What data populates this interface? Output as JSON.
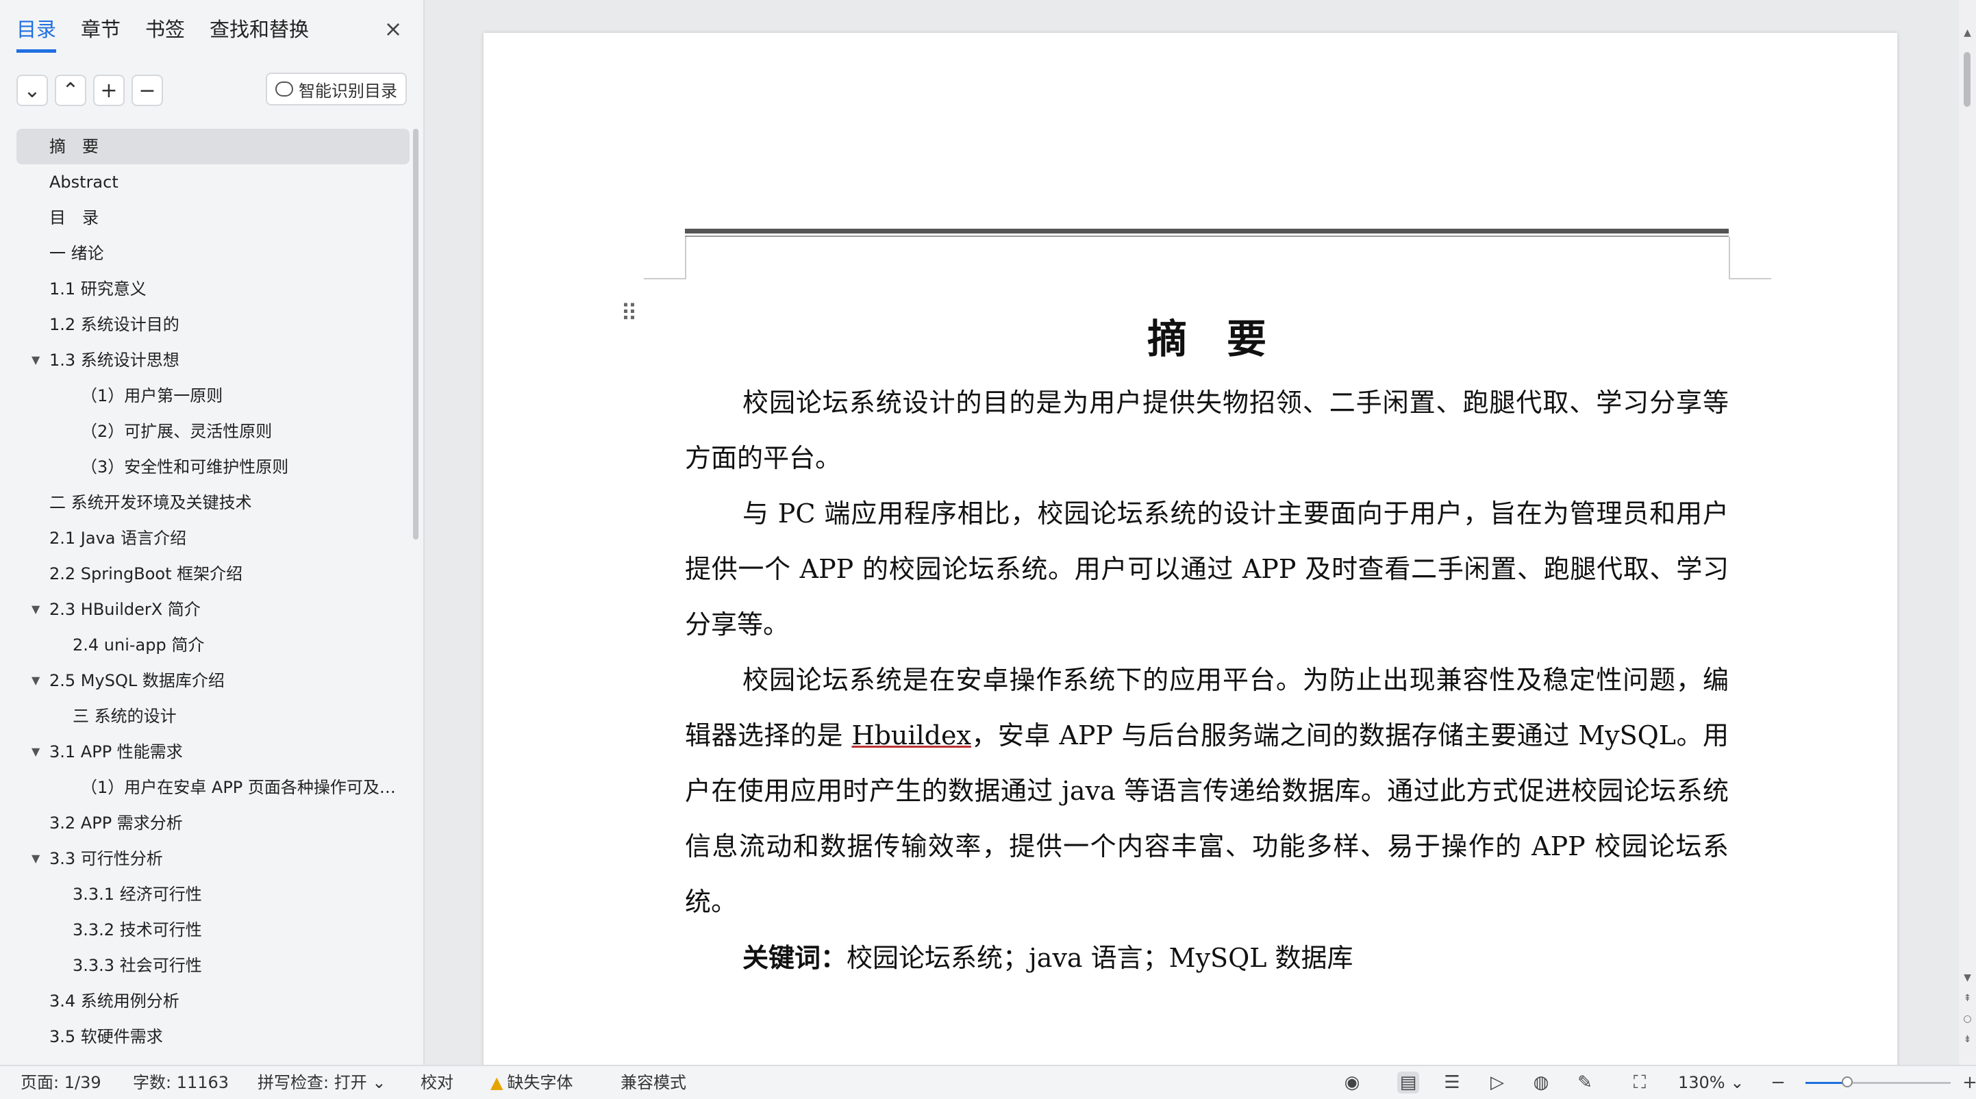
{
  "sidebar": {
    "tabs": [
      {
        "label": "目录",
        "active": true
      },
      {
        "label": "章节",
        "active": false
      },
      {
        "label": "书签",
        "active": false
      },
      {
        "label": "查找和替换",
        "active": false
      }
    ],
    "close_label": "×",
    "tool_buttons": [
      "⌄",
      "⌃",
      "+",
      "−"
    ],
    "smart_button_label": "智能识别目录",
    "toc": [
      {
        "label": "摘　要",
        "level": 1,
        "selected": true
      },
      {
        "label": "Abstract",
        "level": 1
      },
      {
        "label": "目　录",
        "level": 1
      },
      {
        "label": "一 绪论",
        "level": 1
      },
      {
        "label": "1.1 研究意义",
        "level": 1
      },
      {
        "label": "1.2 系统设计目的",
        "level": 1
      },
      {
        "label": "1.3 系统设计思想",
        "level": 1,
        "expanded": true
      },
      {
        "label": "（1）用户第一原则",
        "level": 2
      },
      {
        "label": "（2）可扩展、灵活性原则",
        "level": 2
      },
      {
        "label": "（3）安全性和可维护性原则",
        "level": 2
      },
      {
        "label": "二 系统开发环境及关键技术",
        "level": 1
      },
      {
        "label": "2.1 Java 语言介绍",
        "level": 1
      },
      {
        "label": "2.2 SpringBoot 框架介绍",
        "level": 1
      },
      {
        "label": "2.3 HBuilderX 简介",
        "level": 1,
        "expanded": true
      },
      {
        "label": "2.4 uni-app 简介",
        "level": 2
      },
      {
        "label": "2.5 MySQL 数据库介绍",
        "level": 1,
        "expanded": true
      },
      {
        "label": "三 系统的设计",
        "level": 2
      },
      {
        "label": "3.1 APP 性能需求",
        "level": 1,
        "expanded": true
      },
      {
        "label": "（1）用户在安卓 APP 页面各种操作可及…",
        "level": 2
      },
      {
        "label": "3.2 APP 需求分析",
        "level": 1
      },
      {
        "label": "3.3 可行性分析",
        "level": 1,
        "expanded": true
      },
      {
        "label": "3.3.1 经济可行性",
        "level": 2
      },
      {
        "label": "3.3.2 技术可行性",
        "level": 2
      },
      {
        "label": "3.3.3 社会可行性",
        "level": 2
      },
      {
        "label": "3.4 系统用例分析",
        "level": 1
      },
      {
        "label": "3.5 软硬件需求",
        "level": 1
      }
    ]
  },
  "document": {
    "title": "摘　要",
    "paragraphs": [
      "校园论坛系统设计的目的是为用户提供失物招领、二手闲置、跑腿代取、学习分享等方面的平台。",
      "与 PC 端应用程序相比，校园论坛系统的设计主要面向于用户，旨在为管理员和用户提供一个 APP 的校园论坛系统。用户可以通过 APP 及时查看二手闲置、跑腿代取、学习分享等。"
    ],
    "para3_before": "校园论坛系统是在安卓操作系统下的应用平台。为防止出现兼容性及稳定性问题，编辑器选择的是 ",
    "para3_underlined": "Hbuildex",
    "para3_after": "，安卓 APP 与后台服务端之间的数据存储主要通过 MySQL。用户在使用应用时产生的数据通过 java 等语言传递给数据库。通过此方式促进校园论坛系统信息流动和数据传输效率，提供一个内容丰富、功能多样、易于操作的 APP 校园论坛系统。",
    "keywords_label": "关键词：",
    "keywords": "校园论坛系统；java 语言；MySQL 数据库"
  },
  "statusbar": {
    "page": "页面: 1/39",
    "word_count": "字数: 11163",
    "spellcheck": "拼写检查: 打开",
    "proofread": "校对",
    "missing_font": "缺失字体",
    "compat_mode": "兼容模式",
    "zoom": "130%",
    "zoom_fraction": 0.29
  }
}
